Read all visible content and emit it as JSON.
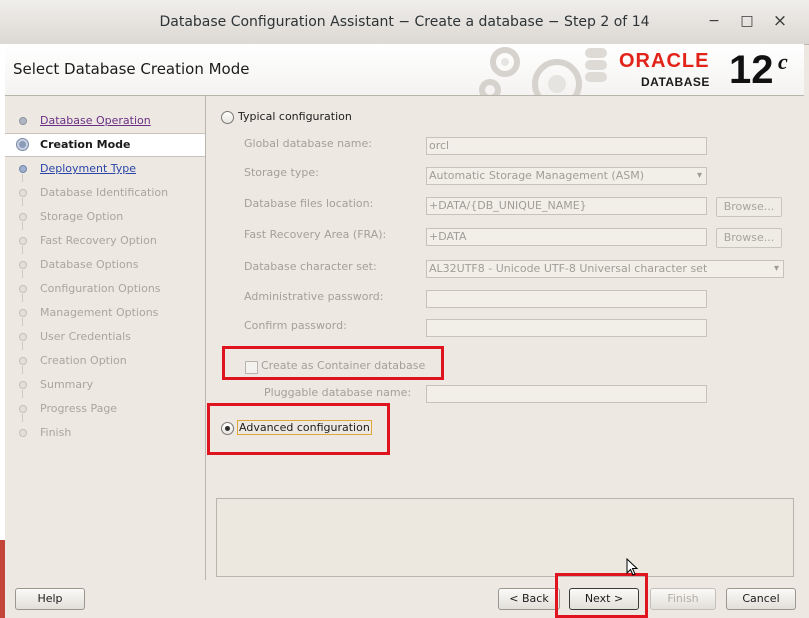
{
  "window": {
    "title": "Database Configuration Assistant − Create a database − Step 2 of 14",
    "minimize_symbol": "−",
    "maximize_symbol": "□",
    "close_symbol": "×"
  },
  "header": {
    "page_title": "Select Database Creation Mode",
    "brand_oracle": "ORACLE",
    "brand_database": "DATABASE",
    "brand_version": "12",
    "brand_version_suffix": "c",
    "brand_color": "#e2231a"
  },
  "nav": {
    "items": [
      {
        "label": "Database Operation",
        "state": "done"
      },
      {
        "label": "Creation Mode",
        "state": "active"
      },
      {
        "label": "Deployment Type",
        "state": "link"
      },
      {
        "label": "Database Identification",
        "state": "future"
      },
      {
        "label": "Storage Option",
        "state": "future"
      },
      {
        "label": "Fast Recovery Option",
        "state": "future"
      },
      {
        "label": "Database Options",
        "state": "future"
      },
      {
        "label": "Configuration Options",
        "state": "future"
      },
      {
        "label": "Management Options",
        "state": "future"
      },
      {
        "label": "User Credentials",
        "state": "future"
      },
      {
        "label": "Creation Option",
        "state": "future"
      },
      {
        "label": "Summary",
        "state": "future"
      },
      {
        "label": "Progress Page",
        "state": "future"
      },
      {
        "label": "Finish",
        "state": "future"
      }
    ]
  },
  "typical": {
    "radio_label": "Typical configuration",
    "selected": false,
    "fields": {
      "global_db_name": {
        "label": "Global database name:",
        "value": "orcl"
      },
      "storage_type": {
        "label": "Storage type:",
        "value": "Automatic Storage Management (ASM)"
      },
      "db_files_location": {
        "label": "Database files location:",
        "value": "+DATA/{DB_UNIQUE_NAME}",
        "browse": "Browse..."
      },
      "fra": {
        "label": "Fast Recovery Area (FRA):",
        "value": "+DATA",
        "browse": "Browse..."
      },
      "charset": {
        "label": "Database character set:",
        "value": "AL32UTF8 - Unicode UTF-8 Universal character set"
      },
      "admin_password": {
        "label": "Administrative password:",
        "value": ""
      },
      "confirm_password": {
        "label": "Confirm password:",
        "value": ""
      }
    },
    "container_label": "Create as Container database",
    "container_checked": false,
    "pluggable_label": "Pluggable database name:",
    "pluggable_value": ""
  },
  "advanced": {
    "radio_label": "Advanced configuration",
    "selected": true
  },
  "buttons": {
    "help": "Help",
    "back": "< Back",
    "next": "Next >",
    "finish": "Finish",
    "cancel": "Cancel"
  },
  "highlight_color": "#e0141e"
}
